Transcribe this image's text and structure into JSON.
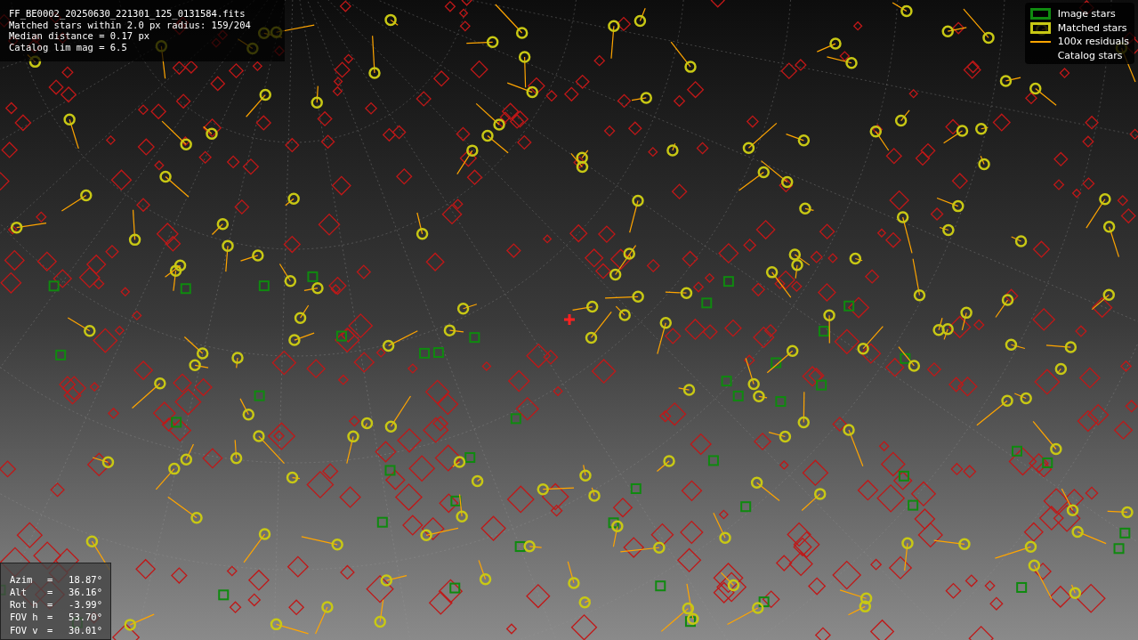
{
  "info": {
    "lines": [
      "FF_BE0002_20250630_221301_125_0131584.fits",
      "Matched stars within 2.0 px radius: 159/204",
      "Median distance = 0.17 px",
      "Catalog lim mag = 6.5"
    ]
  },
  "legend": [
    {
      "kind": "box",
      "color": "#0f8a0f",
      "label": "Image stars"
    },
    {
      "kind": "box",
      "color": "#c8c814",
      "label": "Matched stars"
    },
    {
      "kind": "line",
      "color": "#ffa500",
      "label": "100x residuals"
    },
    {
      "kind": "none",
      "label": "Catalog stars"
    }
  ],
  "pointing": [
    {
      "label": "Azim",
      "sep": "=",
      "value": "18.87°"
    },
    {
      "label": "Alt",
      "sep": "=",
      "value": "36.16°"
    },
    {
      "label": "Rot h",
      "sep": "=",
      "value": "-3.99°"
    },
    {
      "label": "FOV h",
      "sep": "=",
      "value": "53.70°"
    },
    {
      "label": "FOV v",
      "sep": "=",
      "value": "30.01°"
    }
  ]
}
